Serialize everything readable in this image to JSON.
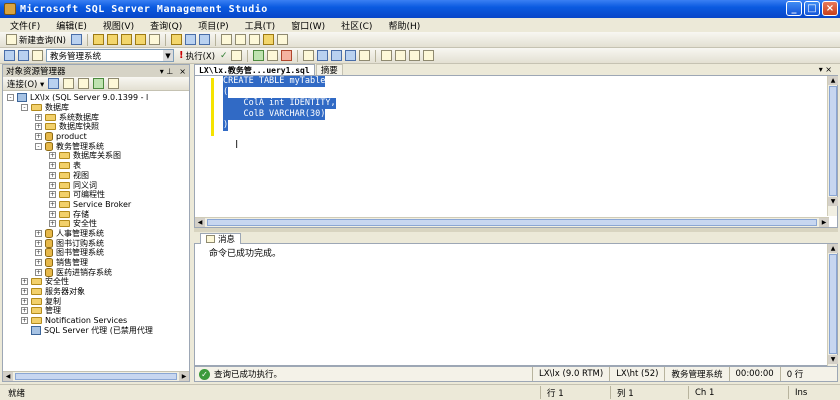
{
  "window": {
    "title": "Microsoft SQL Server Management Studio",
    "minimize": "_",
    "maximize": "□",
    "close": "×"
  },
  "menu": [
    "文件(F)",
    "编辑(E)",
    "视图(V)",
    "查询(Q)",
    "项目(P)",
    "工具(T)",
    "窗口(W)",
    "社区(C)",
    "帮助(H)"
  ],
  "toolbar": {
    "new_query": "新建查询(N)",
    "database_selected": "教务管理系统",
    "execute": "执行(X)"
  },
  "object_explorer": {
    "title": "对象资源管理器",
    "pin": "▾ ⊥",
    "close": "×",
    "connect": "连接(O) ▾",
    "tree": [
      {
        "label": "LX\\lx (SQL Server 9.0.1399 - l",
        "level": 0,
        "exp": "-",
        "type": "server"
      },
      {
        "label": "数据库",
        "level": 1,
        "exp": "-",
        "type": "folder"
      },
      {
        "label": "系统数据库",
        "level": 2,
        "exp": "+",
        "type": "folder"
      },
      {
        "label": "数据库快照",
        "level": 2,
        "exp": "+",
        "type": "folder"
      },
      {
        "label": "product",
        "level": 2,
        "exp": "+",
        "type": "db"
      },
      {
        "label": "教务管理系统",
        "level": 2,
        "exp": "-",
        "type": "db"
      },
      {
        "label": "数据库关系图",
        "level": 3,
        "exp": "+",
        "type": "folder"
      },
      {
        "label": "表",
        "level": 3,
        "exp": "+",
        "type": "folder"
      },
      {
        "label": "视图",
        "level": 3,
        "exp": "+",
        "type": "folder"
      },
      {
        "label": "同义词",
        "level": 3,
        "exp": "+",
        "type": "folder"
      },
      {
        "label": "可编程性",
        "level": 3,
        "exp": "+",
        "type": "folder"
      },
      {
        "label": "Service Broker",
        "level": 3,
        "exp": "+",
        "type": "folder"
      },
      {
        "label": "存储",
        "level": 3,
        "exp": "+",
        "type": "folder"
      },
      {
        "label": "安全性",
        "level": 3,
        "exp": "+",
        "type": "folder"
      },
      {
        "label": "人事管理系统",
        "level": 2,
        "exp": "+",
        "type": "db"
      },
      {
        "label": "图书订购系统",
        "level": 2,
        "exp": "+",
        "type": "db"
      },
      {
        "label": "图书管理系统",
        "level": 2,
        "exp": "+",
        "type": "db"
      },
      {
        "label": "销售管理",
        "level": 2,
        "exp": "+",
        "type": "db"
      },
      {
        "label": "医药进销存系统",
        "level": 2,
        "exp": "+",
        "type": "db"
      },
      {
        "label": "安全性",
        "level": 1,
        "exp": "+",
        "type": "folder"
      },
      {
        "label": "服务器对象",
        "level": 1,
        "exp": "+",
        "type": "folder"
      },
      {
        "label": "复制",
        "level": 1,
        "exp": "+",
        "type": "folder"
      },
      {
        "label": "管理",
        "level": 1,
        "exp": "+",
        "type": "folder"
      },
      {
        "label": "Notification Services",
        "level": 1,
        "exp": "+",
        "type": "folder"
      },
      {
        "label": "SQL Server 代理 (已禁用代理",
        "level": 1,
        "exp": "",
        "type": "server"
      }
    ]
  },
  "editor": {
    "tab_active": "LX\\lx.教务管...uery1.sql",
    "tab_inactive": "摘要",
    "tab_controls": "▾ ×",
    "code": [
      "CREATE TABLE myTable",
      "(",
      "    ColA int IDENTITY,",
      "    ColB VARCHAR(30)",
      ")"
    ]
  },
  "results": {
    "tab": "消息",
    "message": "命令已成功完成。"
  },
  "query_status": {
    "message": "查询已成功执行。",
    "server": "LX\\lx (9.0 RTM)",
    "user": "LX\\ht (52)",
    "database": "教务管理系统",
    "time": "00:00:00",
    "rows": "0 行"
  },
  "status_bar": {
    "ready": "就绪",
    "line": "行 1",
    "col": "列 1",
    "ch": "Ch 1",
    "mode": "Ins"
  }
}
